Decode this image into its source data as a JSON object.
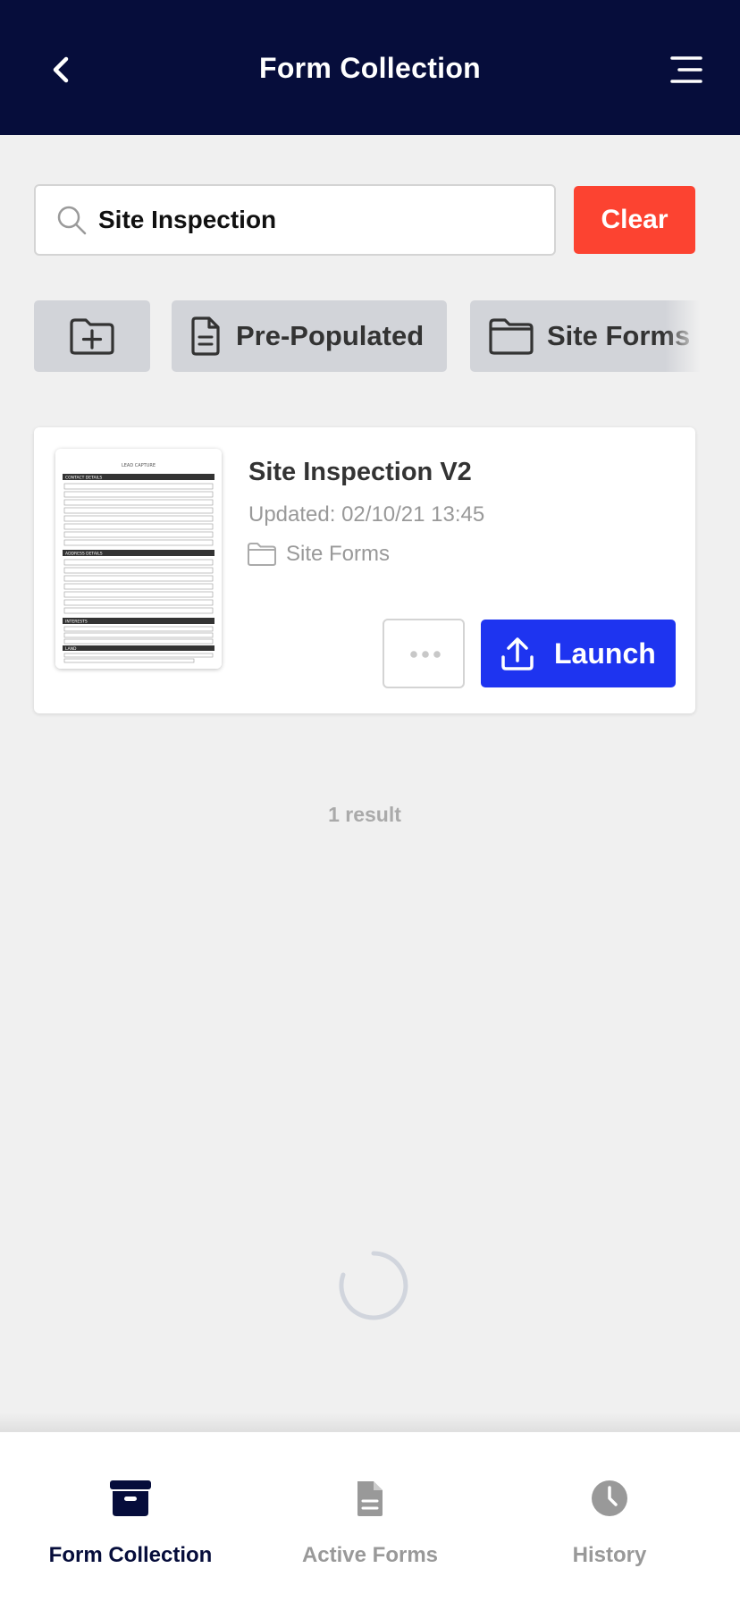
{
  "header": {
    "title": "Form Collection",
    "back_icon": "chevron-left-icon",
    "menu_icon": "hamburger-menu-icon",
    "background": "#060d3b"
  },
  "search": {
    "value": "Site Inspection",
    "clear_label": "Clear",
    "clear_color": "#fc4331"
  },
  "filters": {
    "new_folder_icon": "folder-plus-icon",
    "items": [
      {
        "label": "Pre-Populated",
        "icon": "document-icon"
      },
      {
        "label": "Site Forms",
        "icon": "folder-icon"
      }
    ]
  },
  "results": [
    {
      "title": "Site Inspection V2",
      "updated": "Updated: 02/10/21 13:45",
      "folder": "Site Forms",
      "launch_label": "Launch",
      "launch_color": "#1e34f0",
      "thumbnail": {
        "heading": "LEAD CAPTURE",
        "sections": [
          "CONTACT DETAILS",
          "ADDRESS DETAILS",
          "INTERESTS",
          "LAND"
        ]
      }
    }
  ],
  "result_count": "1 result",
  "bottom_nav": {
    "items": [
      {
        "label": "Form Collection",
        "icon": "archive-box-icon",
        "active": true
      },
      {
        "label": "Active Forms",
        "icon": "document-icon",
        "active": false
      },
      {
        "label": "History",
        "icon": "clock-icon",
        "active": false
      }
    ]
  }
}
